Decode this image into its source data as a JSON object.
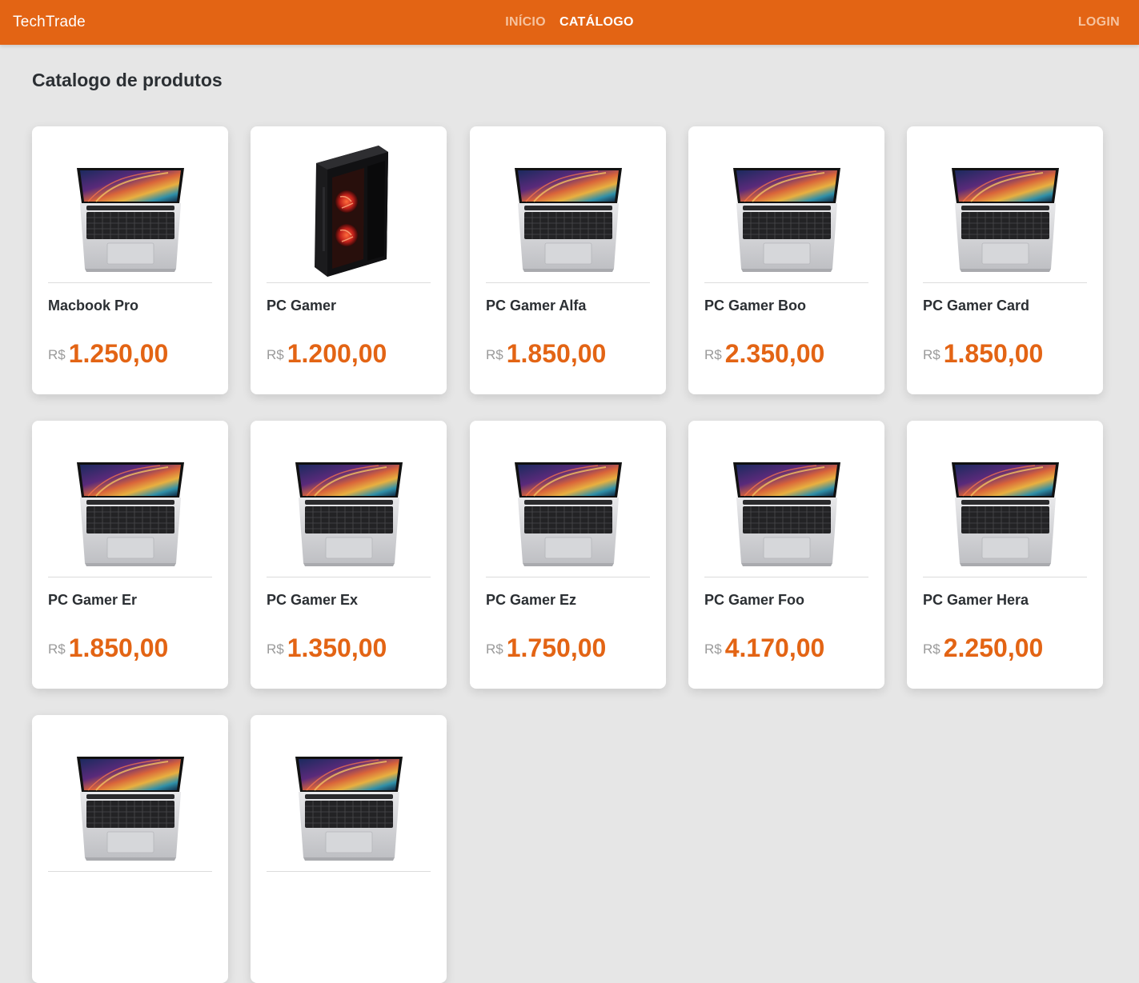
{
  "navbar": {
    "brand": "TechTrade",
    "links": [
      {
        "label": "INÍCIO",
        "active": false
      },
      {
        "label": "CATÁLOGO",
        "active": true
      }
    ],
    "login_label": "LOGIN",
    "color": "#e36414"
  },
  "page": {
    "title": "Catalogo de produtos"
  },
  "products": [
    {
      "name": "Macbook Pro",
      "currency": "R$",
      "price": "1.250,00",
      "icon": "laptop-icon"
    },
    {
      "name": "PC Gamer",
      "currency": "R$",
      "price": "1.200,00",
      "icon": "pc-tower-icon"
    },
    {
      "name": "PC Gamer Alfa",
      "currency": "R$",
      "price": "1.850,00",
      "icon": "laptop-icon"
    },
    {
      "name": "PC Gamer Boo",
      "currency": "R$",
      "price": "2.350,00",
      "icon": "laptop-icon"
    },
    {
      "name": "PC Gamer Card",
      "currency": "R$",
      "price": "1.850,00",
      "icon": "laptop-icon"
    },
    {
      "name": "PC Gamer Er",
      "currency": "R$",
      "price": "1.850,00",
      "icon": "laptop-icon"
    },
    {
      "name": "PC Gamer Ex",
      "currency": "R$",
      "price": "1.350,00",
      "icon": "laptop-icon"
    },
    {
      "name": "PC Gamer Ez",
      "currency": "R$",
      "price": "1.750,00",
      "icon": "laptop-icon"
    },
    {
      "name": "PC Gamer Foo",
      "currency": "R$",
      "price": "4.170,00",
      "icon": "laptop-icon"
    },
    {
      "name": "PC Gamer Hera",
      "currency": "R$",
      "price": "2.250,00",
      "icon": "laptop-icon"
    },
    {
      "name": "",
      "currency": "",
      "price": "",
      "icon": "laptop-icon"
    },
    {
      "name": "",
      "currency": "",
      "price": "",
      "icon": "laptop-icon"
    }
  ]
}
